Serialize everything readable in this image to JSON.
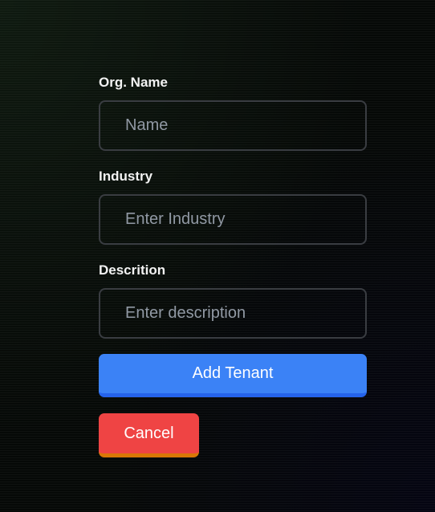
{
  "form": {
    "org_name": {
      "label": "Org. Name",
      "placeholder": "Name",
      "value": ""
    },
    "industry": {
      "label": "Industry",
      "placeholder": "Enter Industry",
      "value": ""
    },
    "description": {
      "label": "Descrition",
      "placeholder": "Enter description",
      "value": ""
    },
    "submit_label": "Add Tenant",
    "cancel_label": "Cancel"
  },
  "colors": {
    "background": "#060907",
    "input_border": "#3a3d42",
    "primary": "#3b82f6",
    "primary_accent": "#2563eb",
    "danger": "#ef4444",
    "danger_accent": "#d97706"
  }
}
